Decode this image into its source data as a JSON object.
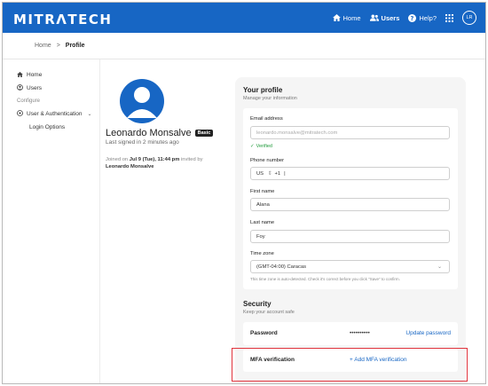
{
  "header": {
    "logo": "MITRΛTECH",
    "nav": [
      {
        "label": "Home",
        "icon": "home-icon"
      },
      {
        "label": "Users",
        "icon": "users-icon"
      },
      {
        "label": "Help?",
        "icon": "help-icon"
      }
    ],
    "avatar_initials": "LR",
    "accent": "#1766c4"
  },
  "breadcrumb": {
    "home": "Home",
    "sep": ">",
    "current": "Profile"
  },
  "sidebar": {
    "home": "Home",
    "users": "Users",
    "configure": "Configure",
    "user_auth": "User & Authentication",
    "login_options": "Login Options"
  },
  "profile": {
    "name": "Leonardo Monsalve",
    "badge": "Basic",
    "last_signed": "Last signed in 2 minutes ago",
    "joined_prefix": "Joined on",
    "joined_date": "Jul 9 (Tue), 11:44 pm",
    "joined_invited": "invited by",
    "joined_by": "Leonardo Monsalve"
  },
  "your_profile": {
    "title": "Your profile",
    "subtitle": "Manage your information",
    "email_label": "Email address",
    "email_value": "leonardo.monsalve@mitratech.com",
    "verified": "Verified",
    "phone_label": "Phone number",
    "phone_country": "US",
    "phone_code": "+1",
    "phone_value": "|",
    "first_name_label": "First name",
    "first_name_value": "Alana",
    "last_name_label": "Last name",
    "last_name_value": "Foy",
    "timezone_label": "Time zone",
    "timezone_value": "(GMT-04:00) Caracas",
    "timezone_hint": "This time zone is auto-detected. Check it's correct before you click \"Save\" to confirm."
  },
  "security": {
    "title": "Security",
    "subtitle": "Keep your account safe",
    "password_label": "Password",
    "password_value": "••••••••••",
    "password_link": "Update password",
    "mfa_label": "MFA verification",
    "mfa_link": "+ Add MFA verification"
  }
}
